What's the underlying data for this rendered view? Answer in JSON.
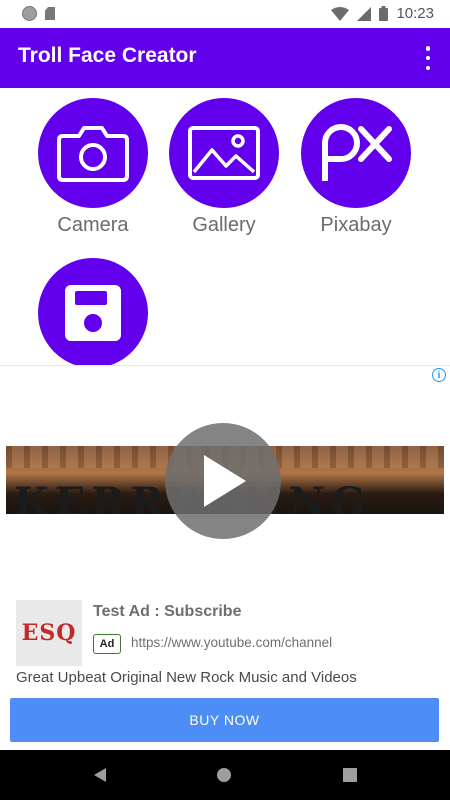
{
  "status_bar": {
    "time": "10:23",
    "icons": [
      "circle-notification-icon",
      "sd-card-icon",
      "wifi-icon",
      "signal-icon",
      "battery-icon"
    ]
  },
  "app_bar": {
    "title": "Troll Face Creator",
    "menu_icon": "overflow-menu-icon",
    "color": "#6200ee"
  },
  "actions": [
    {
      "label": "Camera",
      "icon": "camera-icon"
    },
    {
      "label": "Gallery",
      "icon": "image-icon"
    },
    {
      "label": "Pixabay",
      "icon": "pixabay-icon",
      "glyph": "px"
    },
    {
      "label": "",
      "icon": "save-icon"
    }
  ],
  "ad": {
    "info_glyph": "i",
    "video_text": "KERRY KING",
    "thumb_text": "ESQ",
    "title": "Test Ad : Subscribe",
    "badge": "Ad",
    "url": "https://www.youtube.com/channel",
    "description": "Great Upbeat Original New Rock Music and Videos",
    "cta": "BUY NOW",
    "cta_color": "#4c8ef5"
  },
  "nav_bar": {
    "icons": [
      "back-icon",
      "home-icon",
      "recents-icon"
    ]
  }
}
